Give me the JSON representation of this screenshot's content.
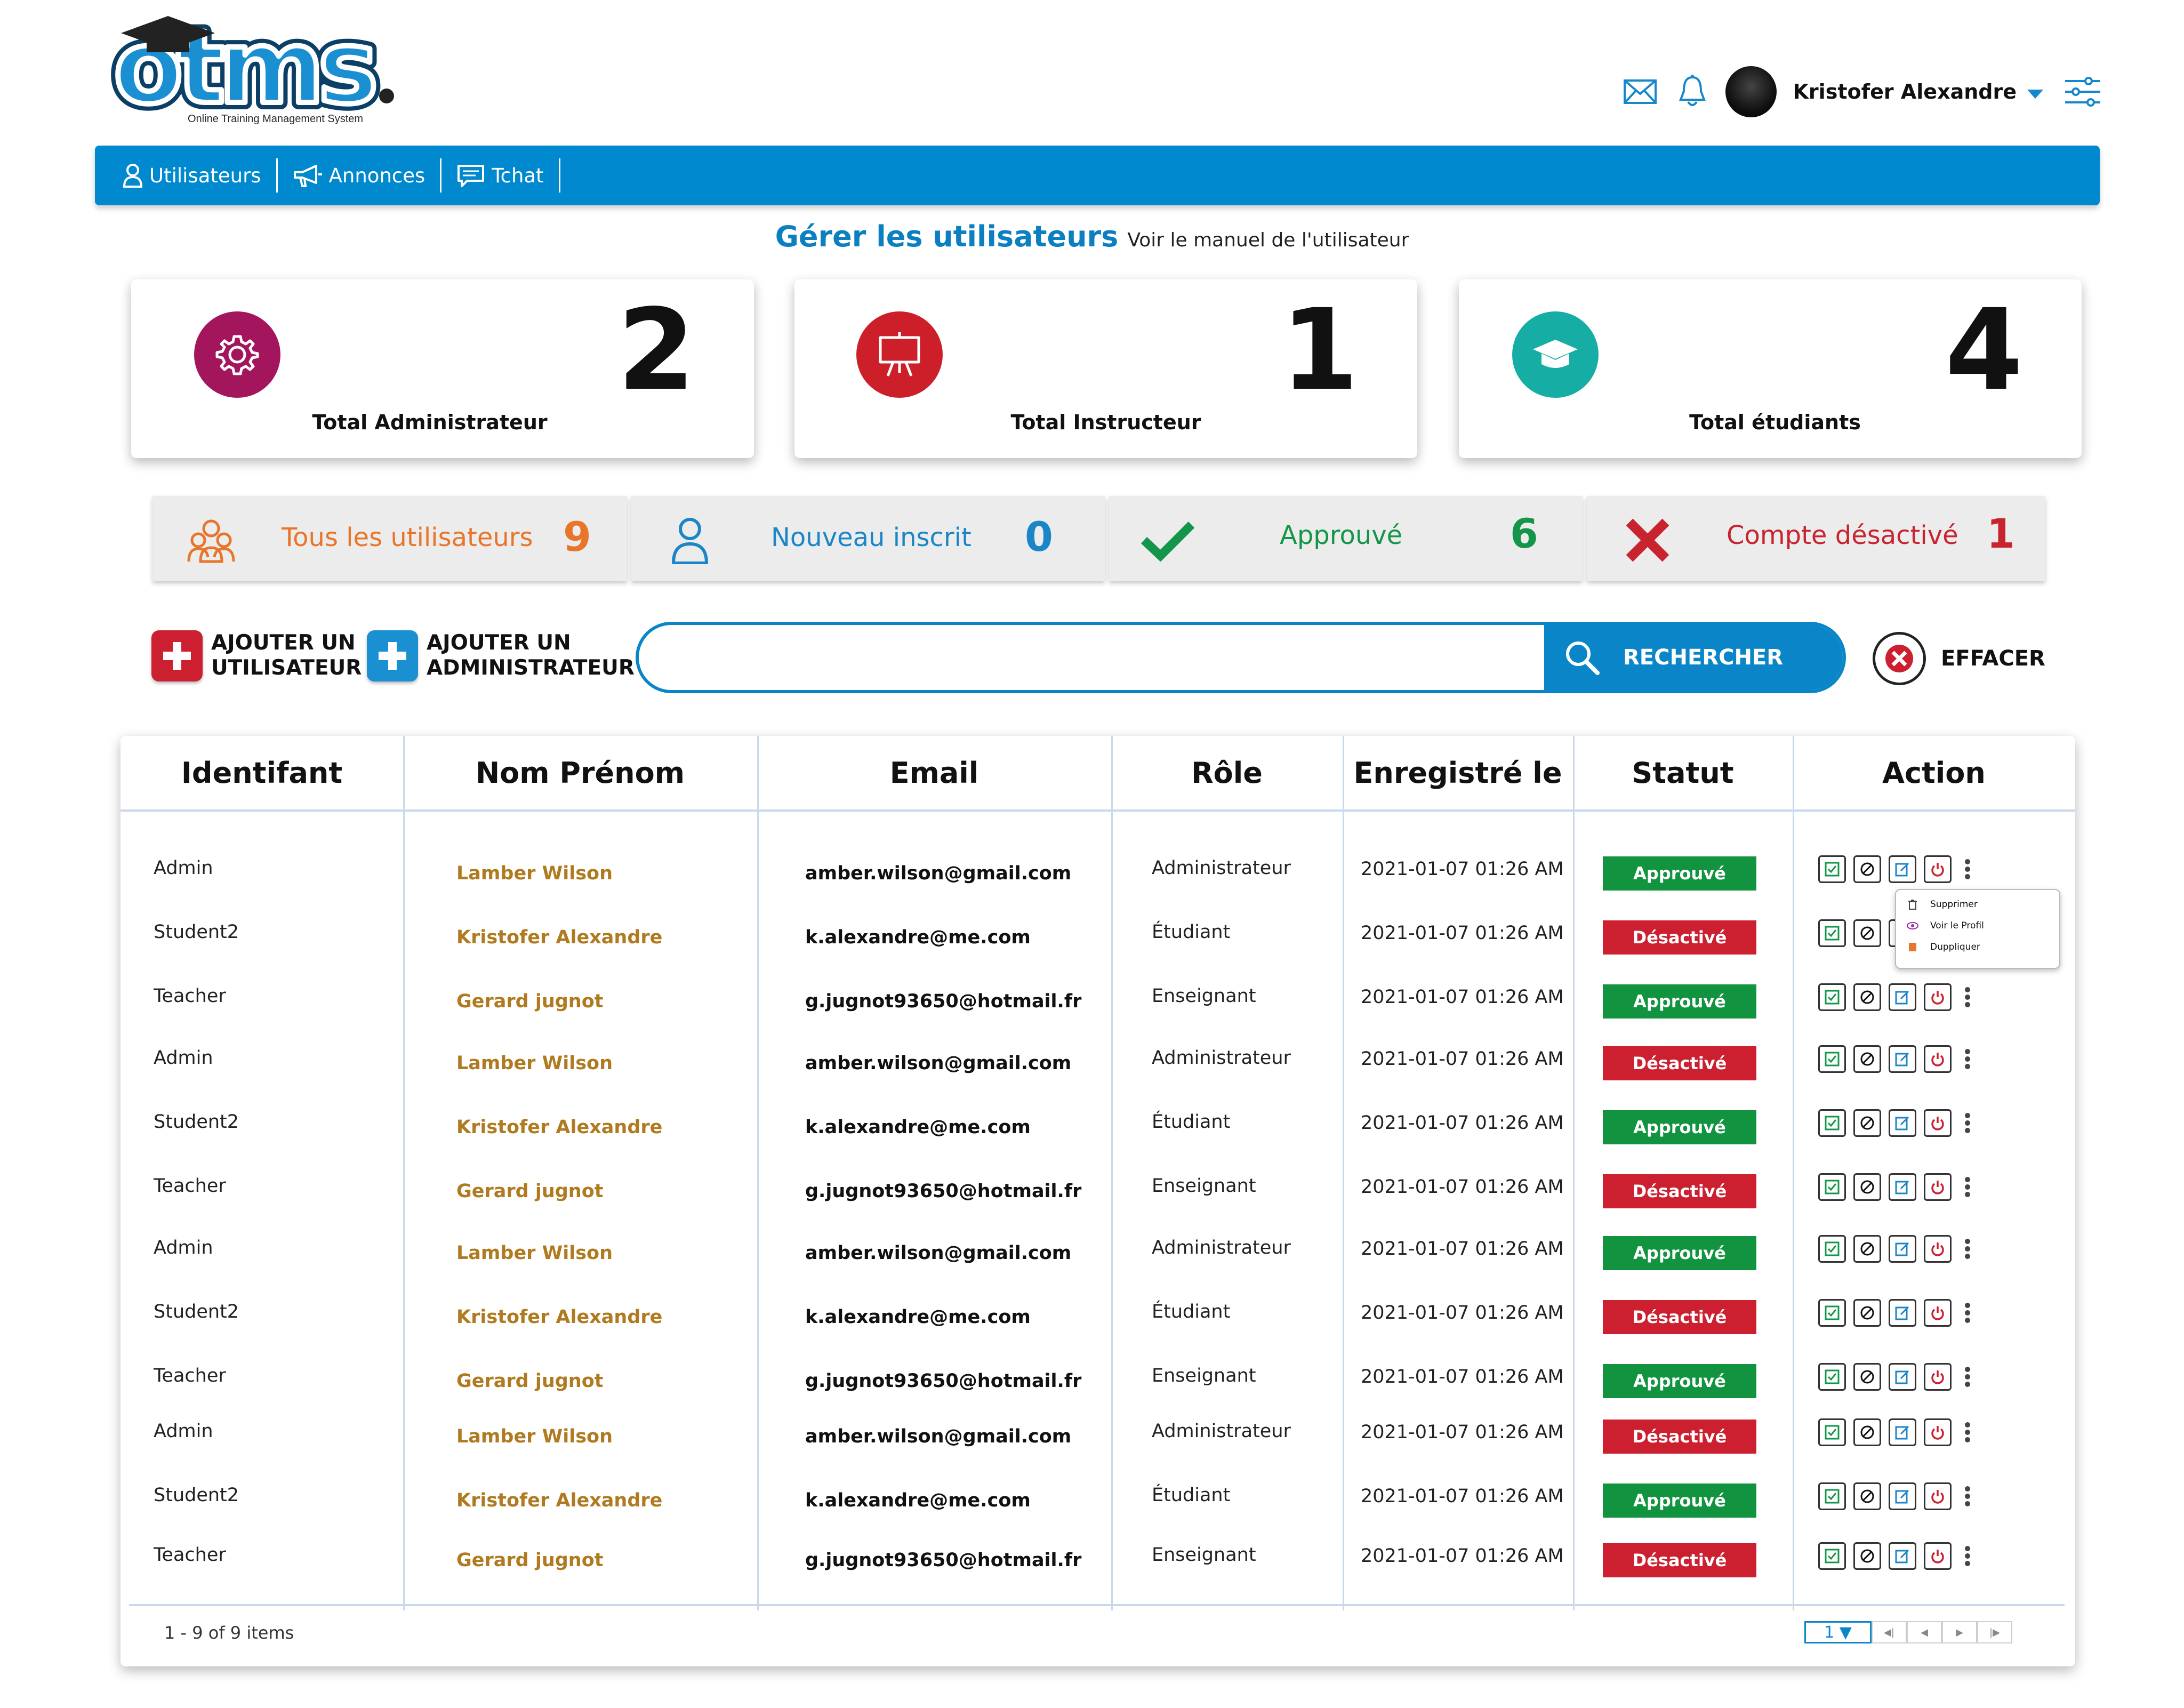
{
  "brand": {
    "logo_text": "otms",
    "tagline": "Online Training Management System"
  },
  "header": {
    "user_name": "Kristofer Alexandre",
    "icons": [
      "mail-icon",
      "bell-icon",
      "settings-sliders-icon"
    ]
  },
  "nav": {
    "items": [
      {
        "label": "Utilisateurs",
        "icon": "user-icon"
      },
      {
        "label": "Annonces",
        "icon": "megaphone-icon"
      },
      {
        "label": "Tchat",
        "icon": "chat-icon"
      }
    ]
  },
  "page": {
    "title": "Gérer les utilisateurs",
    "manual_link": "Voir le manuel de l'utilisateur"
  },
  "stats": [
    {
      "label": "Total Administrateur",
      "value": "2",
      "icon": "gear-icon",
      "color": "#a3155d"
    },
    {
      "label": "Total Instructeur",
      "value": "1",
      "icon": "presentation-board-icon",
      "color": "#cc1f29"
    },
    {
      "label": "Total étudiants",
      "value": "4",
      "icon": "graduation-cap-icon",
      "color": "#16ada4"
    }
  ],
  "filters": [
    {
      "label": "Tous les utilisateurs",
      "count": "9",
      "icon": "users-group-icon",
      "color": "#e8752a"
    },
    {
      "label": "Nouveau inscrit",
      "count": "0",
      "icon": "user-icon",
      "color": "#1a86c8"
    },
    {
      "label": "Approuvé",
      "count": "6",
      "icon": "checkmark-icon",
      "color": "#14964a"
    },
    {
      "label": "Compte désactivé",
      "count": "1",
      "icon": "cross-icon",
      "color": "#c8242f"
    }
  ],
  "actions": {
    "add_user_line1": "AJOUTER UN",
    "add_user_line2": "UTILISATEUR",
    "add_admin_line1": "AJOUTER UN",
    "add_admin_line2": "ADMINISTRATEUR",
    "search_placeholder": "",
    "search_button": "RECHERCHER",
    "clear_button": "EFFACER"
  },
  "table": {
    "headers": [
      "Identifant",
      "Nom Prénom",
      "Email",
      "Rôle",
      "Enregistré le",
      "Statut",
      "Action"
    ],
    "rows": [
      {
        "id": "Admin",
        "name": "Lamber Wilson",
        "email": "amber.wilson@gmail.com",
        "role": "Administrateur",
        "date": "2021-01-07 01:26 AM",
        "status": "Approuvé"
      },
      {
        "id": "Student2",
        "name": "Kristofer Alexandre",
        "email": "k.alexandre@me.com",
        "role": "Étudiant",
        "date": "2021-01-07 01:26 AM",
        "status": "Désactivé"
      },
      {
        "id": "Teacher",
        "name": "Gerard jugnot",
        "email": "g.jugnot93650@hotmail.fr",
        "role": "Enseignant",
        "date": "2021-01-07 01:26 AM",
        "status": "Approuvé"
      },
      {
        "id": "Admin",
        "name": "Lamber Wilson",
        "email": "amber.wilson@gmail.com",
        "role": "Administrateur",
        "date": "2021-01-07 01:26 AM",
        "status": "Désactivé"
      },
      {
        "id": "Student2",
        "name": "Kristofer Alexandre",
        "email": "k.alexandre@me.com",
        "role": "Étudiant",
        "date": "2021-01-07 01:26 AM",
        "status": "Approuvé"
      },
      {
        "id": "Teacher",
        "name": "Gerard jugnot",
        "email": "g.jugnot93650@hotmail.fr",
        "role": "Enseignant",
        "date": "2021-01-07 01:26 AM",
        "status": "Désactivé"
      },
      {
        "id": "Admin",
        "name": "Lamber Wilson",
        "email": "amber.wilson@gmail.com",
        "role": "Administrateur",
        "date": "2021-01-07 01:26 AM",
        "status": "Approuvé"
      },
      {
        "id": "Student2",
        "name": "Kristofer Alexandre",
        "email": "k.alexandre@me.com",
        "role": "Étudiant",
        "date": "2021-01-07 01:26 AM",
        "status": "Désactivé"
      },
      {
        "id": "Teacher",
        "name": "Gerard jugnot",
        "email": "g.jugnot93650@hotmail.fr",
        "role": "Enseignant",
        "date": "2021-01-07 01:26 AM",
        "status": "Approuvé"
      },
      {
        "id": "Admin",
        "name": "Lamber Wilson",
        "email": "amber.wilson@gmail.com",
        "role": "Administrateur",
        "date": "2021-01-07 01:26 AM",
        "status": "Désactivé"
      },
      {
        "id": "Student2",
        "name": "Kristofer Alexandre",
        "email": "k.alexandre@me.com",
        "role": "Étudiant",
        "date": "2021-01-07 01:26 AM",
        "status": "Approuvé"
      },
      {
        "id": "Teacher",
        "name": "Gerard jugnot",
        "email": "g.jugnot93650@hotmail.fr",
        "role": "Enseignant",
        "date": "2021-01-07 01:26 AM",
        "status": "Désactivé"
      }
    ],
    "status_colors": {
      "Approuvé": "#12933f",
      "Désactivé": "#cc1f2f"
    },
    "row_actions": [
      "approve-icon",
      "block-icon",
      "edit-icon",
      "power-icon"
    ],
    "dropdown": [
      "Supprimer",
      "Voir le Profil",
      "Duppliquer"
    ],
    "footer_info": "1 - 9 of 9 items",
    "current_page": "1"
  }
}
